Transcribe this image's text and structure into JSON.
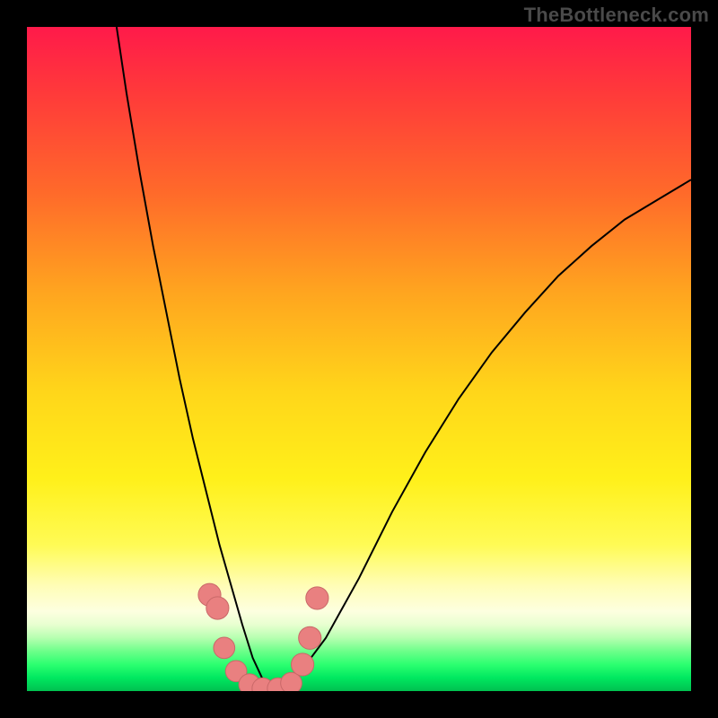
{
  "watermark": {
    "text": "TheBottleneck.com"
  },
  "colors": {
    "curve_stroke": "#000000",
    "marker_fill": "#e98080",
    "marker_stroke": "#c96868"
  },
  "chart_data": {
    "type": "line",
    "title": "",
    "xlabel": "",
    "ylabel": "",
    "xlim": [
      0,
      100
    ],
    "ylim": [
      0,
      100
    ],
    "grid": false,
    "series": [
      {
        "name": "bottleneck-curve",
        "x": [
          13.5,
          15,
          17,
          19,
          21,
          23,
          25,
          27,
          29,
          31,
          32.43,
          34,
          36,
          38,
          40,
          45,
          50,
          55,
          60,
          65,
          70,
          75,
          80,
          85,
          90,
          95,
          100
        ],
        "y": [
          100,
          90,
          78,
          67,
          57,
          47,
          38,
          30,
          22,
          15,
          10,
          5,
          0.7,
          0,
          1.3,
          8,
          17,
          27,
          36,
          44,
          51,
          57,
          62.5,
          67,
          71,
          74,
          77
        ]
      }
    ],
    "markers": [
      {
        "x": 27.5,
        "y": 14.5,
        "r": 1.7
      },
      {
        "x": 28.7,
        "y": 12.5,
        "r": 1.7
      },
      {
        "x": 29.7,
        "y": 6.5,
        "r": 1.6
      },
      {
        "x": 31.5,
        "y": 3.0,
        "r": 1.6
      },
      {
        "x": 33.5,
        "y": 1.0,
        "r": 1.6
      },
      {
        "x": 35.5,
        "y": 0.4,
        "r": 1.6
      },
      {
        "x": 37.8,
        "y": 0.4,
        "r": 1.6
      },
      {
        "x": 39.8,
        "y": 1.2,
        "r": 1.6
      },
      {
        "x": 41.5,
        "y": 4.0,
        "r": 1.7
      },
      {
        "x": 42.6,
        "y": 8.0,
        "r": 1.7
      },
      {
        "x": 43.7,
        "y": 14.0,
        "r": 1.7
      }
    ]
  }
}
